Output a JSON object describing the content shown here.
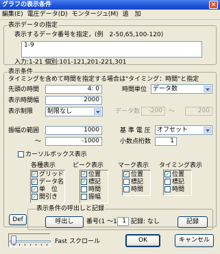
{
  "window": {
    "title": "グラフの表示条件",
    "close_glyph": "×"
  },
  "menu": [
    "編集(E)",
    "電圧データ(D)",
    "モンタージュ(M)",
    "追　加"
  ],
  "data_spec": {
    "legend": "表示データの指定",
    "instruction": "表示するデータ番号を指定，(例　2-50,65,100-120)",
    "value": "1-9",
    "input_info": "入力:1-21 個別:101-121,201-221,301"
  },
  "display_cond": {
    "legend": "表示条件",
    "timing_note": "タイミングを含めて時間を指定する場合は\"タイミング：時間\"と指定",
    "start_time_label": "先頭の時間",
    "start_time_value": "4: 0",
    "time_unit_label": "時間単位",
    "time_unit_value": "データ数",
    "width_label": "表示時間幅",
    "width_value": "2000",
    "limit_label": "表示制限",
    "limit_value": "制限なし",
    "data_count_label": "データ数",
    "data_count_from": "-200",
    "data_count_sep": "～",
    "data_count_to": "200",
    "amp_range_label": "振幅の範囲",
    "amp_from": "1000",
    "amp_sep": "～",
    "amp_to": "-1000",
    "ref_voltage_label": "基 準 電 圧",
    "ref_voltage_value": "オフセット",
    "decimals_label": "小数点桁数",
    "decimals_value": "1"
  },
  "cursor_box": {
    "label": "カーソルボックス表示",
    "checked": false,
    "groups": [
      {
        "title": "各種表示",
        "items": [
          {
            "label": "グリッド",
            "checked": true
          },
          {
            "label": "データ名",
            "checked": true
          },
          {
            "label": "単　位",
            "checked": true
          },
          {
            "label": "間引き",
            "checked": true
          }
        ]
      },
      {
        "title": "ピーク表示",
        "items": [
          {
            "label": "位置",
            "checked": true
          },
          {
            "label": "標記",
            "checked": true
          },
          {
            "label": "時間",
            "checked": false
          },
          {
            "label": "振幅",
            "checked": false
          }
        ]
      },
      {
        "title": "マーク表示",
        "items": [
          {
            "label": "位置",
            "checked": true
          },
          {
            "label": "標記",
            "checked": false
          },
          {
            "label": "時間",
            "checked": false
          }
        ]
      },
      {
        "title": "タイミング表示",
        "items": [
          {
            "label": "位置",
            "checked": true
          },
          {
            "label": "標記",
            "checked": false
          },
          {
            "label": "時間",
            "checked": false
          }
        ]
      }
    ]
  },
  "recall": {
    "legend": "表示条件の呼出しと記録",
    "def_button": "Def",
    "recall_button": "呼出し",
    "number_label": "番号(1 ～10)",
    "number_value": "1",
    "record_status": "記録: なし",
    "record_button": "記録"
  },
  "footer": {
    "slider_label": "Fast スクロール",
    "ok_button": "OK",
    "cancel_button": "キャンセル"
  }
}
